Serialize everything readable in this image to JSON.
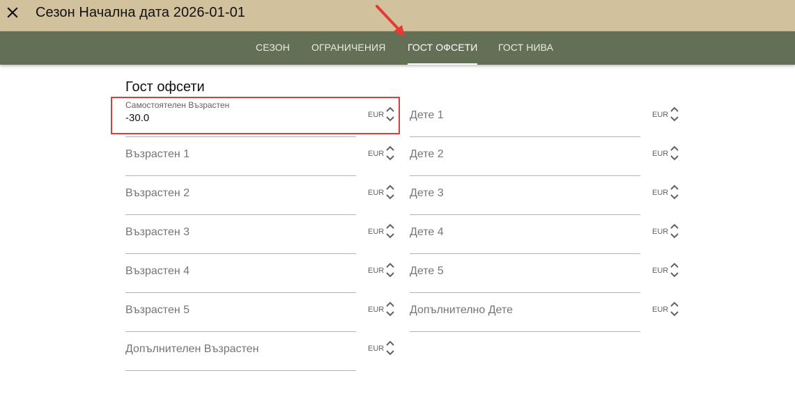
{
  "header": {
    "title": "Сезон Начална дата 2026-01-01",
    "close_icon": "close-icon"
  },
  "tabs": [
    {
      "label": "СЕЗОН",
      "active": false
    },
    {
      "label": "ОГРАНИЧЕНИЯ",
      "active": false
    },
    {
      "label": "ГОСТ ОФСЕТИ",
      "active": true
    },
    {
      "label": "ГОСТ НИВА",
      "active": false
    }
  ],
  "section": {
    "title": "Гост офсети"
  },
  "fields": {
    "standalone_adult": {
      "label": "Самостоятелен Възрастен",
      "value": "-30.0",
      "suffix": "EUR"
    },
    "adult_1": {
      "label": "Възрастен 1",
      "value": "",
      "suffix": "EUR"
    },
    "adult_2": {
      "label": "Възрастен 2",
      "value": "",
      "suffix": "EUR"
    },
    "adult_3": {
      "label": "Възрастен 3",
      "value": "",
      "suffix": "EUR"
    },
    "adult_4": {
      "label": "Възрастен 4",
      "value": "",
      "suffix": "EUR"
    },
    "adult_5": {
      "label": "Възрастен 5",
      "value": "",
      "suffix": "EUR"
    },
    "extra_adult": {
      "label": "Допълнителен Възрастен",
      "value": "",
      "suffix": "EUR"
    },
    "child_1": {
      "label": "Дете 1",
      "value": "",
      "suffix": "EUR"
    },
    "child_2": {
      "label": "Дете 2",
      "value": "",
      "suffix": "EUR"
    },
    "child_3": {
      "label": "Дете 3",
      "value": "",
      "suffix": "EUR"
    },
    "child_4": {
      "label": "Дете 4",
      "value": "",
      "suffix": "EUR"
    },
    "child_5": {
      "label": "Дете 5",
      "value": "",
      "suffix": "EUR"
    },
    "extra_child": {
      "label": "Допълнително Дете",
      "value": "",
      "suffix": "EUR"
    }
  },
  "colors": {
    "topbar": "#d1c19c",
    "tabbar": "#637055",
    "highlight": "#e53935"
  }
}
